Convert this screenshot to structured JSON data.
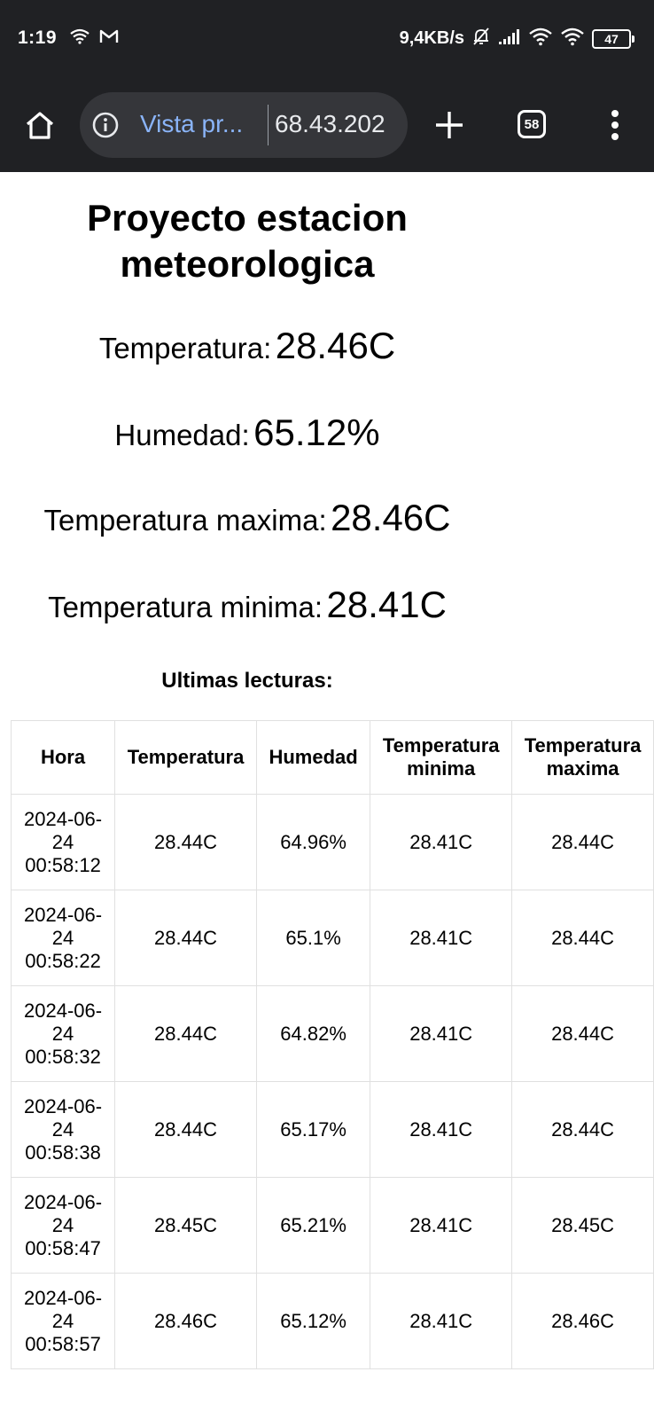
{
  "status_bar": {
    "time": "1:19",
    "net_speed": "9,4KB/s",
    "battery": "47"
  },
  "browser": {
    "page_title_short": "Vista pr...",
    "url": "68.43.202",
    "tab_count": "58"
  },
  "page": {
    "title": "Proyecto estacion meteorologica",
    "readings": [
      {
        "label": "Temperatura:",
        "value": "28.46C"
      },
      {
        "label": "Humedad:",
        "value": "65.12%"
      },
      {
        "label": "Temperatura maxima:",
        "value": "28.46C"
      },
      {
        "label": "Temperatura minima:",
        "value": "28.41C"
      }
    ],
    "table_heading": "Ultimas lecturas:",
    "table": {
      "headers": [
        "Hora",
        "Temperatura",
        "Humedad",
        "Temperatura minima",
        "Temperatura maxima"
      ],
      "rows": [
        [
          "2024-06-24 00:58:12",
          "28.44C",
          "64.96%",
          "28.41C",
          "28.44C"
        ],
        [
          "2024-06-24 00:58:22",
          "28.44C",
          "65.1%",
          "28.41C",
          "28.44C"
        ],
        [
          "2024-06-24 00:58:32",
          "28.44C",
          "64.82%",
          "28.41C",
          "28.44C"
        ],
        [
          "2024-06-24 00:58:38",
          "28.44C",
          "65.17%",
          "28.41C",
          "28.44C"
        ],
        [
          "2024-06-24 00:58:47",
          "28.45C",
          "65.21%",
          "28.41C",
          "28.45C"
        ],
        [
          "2024-06-24 00:58:57",
          "28.46C",
          "65.12%",
          "28.41C",
          "28.46C"
        ]
      ]
    }
  }
}
